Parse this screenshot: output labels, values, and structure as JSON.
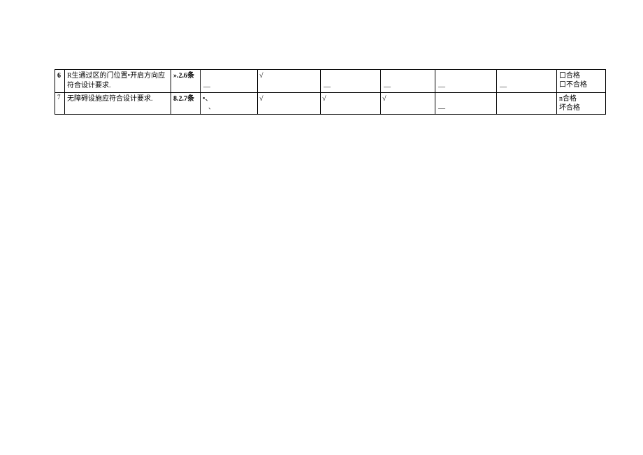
{
  "rows": [
    {
      "num": "6",
      "desc_line1": "R生通过区的门位置•开启方向应",
      "desc_line2": "符合设计要求.",
      "ref": "».2.6条",
      "blank1": "—",
      "check1": "√",
      "check2": "—",
      "check3": "—",
      "check4": "—",
      "check5": "—",
      "result_line1": "口合格",
      "result_line2": "口不合格"
    },
    {
      "num": "7",
      "desc": "无障碍设施应符合设计要求.",
      "ref": "8.2.7条",
      "blank1": "•、",
      "blank1_sub": "、",
      "check1": "√",
      "check2": "√",
      "check3": "√",
      "check4": "—",
      "result_line1": "n合格",
      "result_line2": "坏合格"
    }
  ]
}
